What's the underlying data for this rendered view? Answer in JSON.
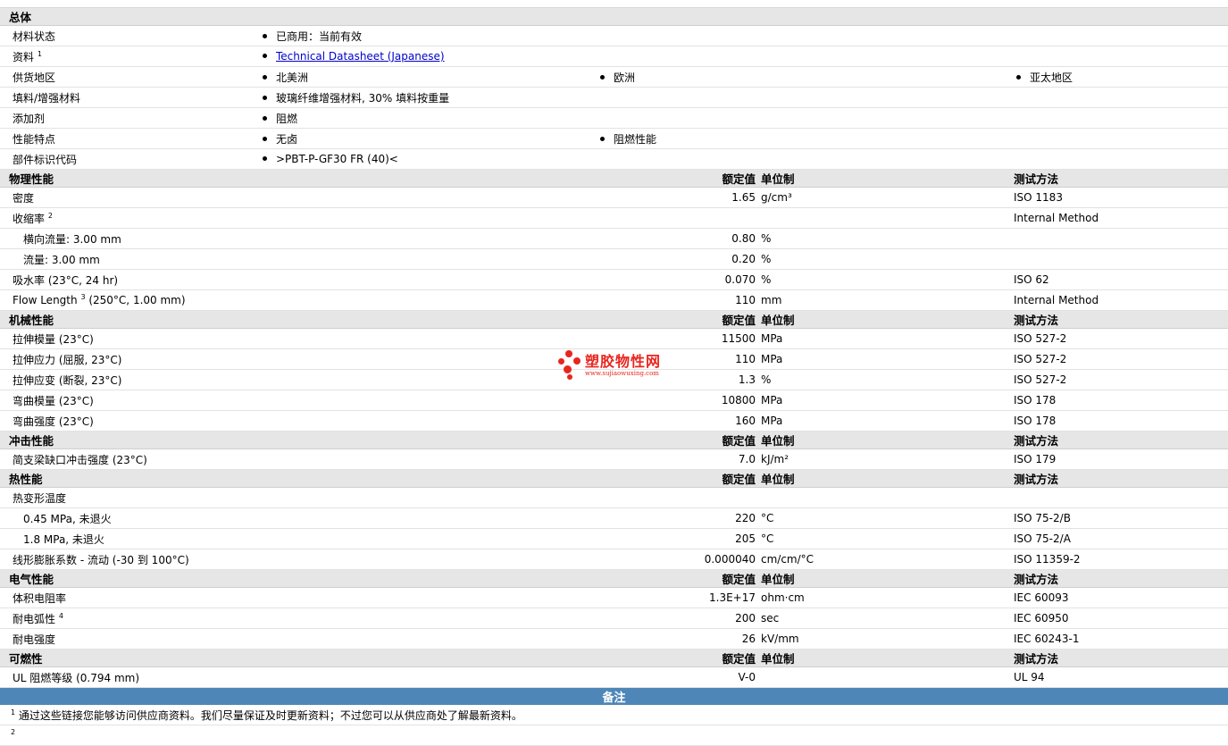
{
  "general": {
    "title": "总体",
    "rows": [
      {
        "label": "材料状态",
        "sup": "",
        "values": [
          "已商用：当前有效"
        ]
      },
      {
        "label": "资料",
        "sup": "1",
        "link": "Technical Datasheet (Japanese)"
      },
      {
        "label": "供货地区",
        "sup": "",
        "values": [
          "北美洲",
          "欧洲",
          "亚太地区"
        ]
      },
      {
        "label": "填料/增强材料",
        "sup": "",
        "values": [
          "玻璃纤维增强材料, 30% 填料按重量"
        ]
      },
      {
        "label": "添加剂",
        "sup": "",
        "values": [
          "阻燃"
        ]
      },
      {
        "label": "性能特点",
        "sup": "",
        "values": [
          "无卤",
          "阻燃性能"
        ]
      },
      {
        "label": "部件标识代码",
        "sup": "",
        "values": [
          ">PBT-P-GF30 FR (40)<"
        ]
      }
    ]
  },
  "headers": {
    "nominal": "额定值",
    "unit": "单位制",
    "method": "测试方法"
  },
  "sections": [
    {
      "title": "物理性能",
      "rows": [
        {
          "label": "密度",
          "sup": "",
          "indent": false,
          "value": "1.65",
          "unit": "g/cm³",
          "method": "ISO 1183"
        },
        {
          "label": "收缩率",
          "sup": "2",
          "indent": false,
          "value": "",
          "unit": "",
          "method": "Internal Method"
        },
        {
          "label": "横向流量: 3.00 mm",
          "sup": "",
          "indent": true,
          "value": "0.80",
          "unit": "%",
          "method": ""
        },
        {
          "label": "流量: 3.00 mm",
          "sup": "",
          "indent": true,
          "value": "0.20",
          "unit": "%",
          "method": ""
        },
        {
          "label": "吸水率  (23°C, 24 hr)",
          "sup": "",
          "indent": false,
          "value": "0.070",
          "unit": "%",
          "method": "ISO 62"
        },
        {
          "label": "Flow Length",
          "sup": "3",
          "suffix": " (250°C, 1.00 mm)",
          "indent": false,
          "value": "110",
          "unit": "mm",
          "method": "Internal Method"
        }
      ]
    },
    {
      "title": "机械性能",
      "rows": [
        {
          "label": "拉伸模量  (23°C)",
          "sup": "",
          "indent": false,
          "value": "11500",
          "unit": "MPa",
          "method": "ISO 527-2"
        },
        {
          "label": "拉伸应力  (屈服, 23°C)",
          "sup": "",
          "indent": false,
          "value": "110",
          "unit": "MPa",
          "method": "ISO 527-2"
        },
        {
          "label": "拉伸应变  (断裂, 23°C)",
          "sup": "",
          "indent": false,
          "value": "1.3",
          "unit": "%",
          "method": "ISO 527-2"
        },
        {
          "label": "弯曲模量  (23°C)",
          "sup": "",
          "indent": false,
          "value": "10800",
          "unit": "MPa",
          "method": "ISO 178"
        },
        {
          "label": "弯曲强度  (23°C)",
          "sup": "",
          "indent": false,
          "value": "160",
          "unit": "MPa",
          "method": "ISO 178"
        }
      ]
    },
    {
      "title": "冲击性能",
      "rows": [
        {
          "label": "简支梁缺口冲击强度  (23°C)",
          "sup": "",
          "indent": false,
          "value": "7.0",
          "unit": "kJ/m²",
          "method": "ISO 179"
        }
      ]
    },
    {
      "title": "热性能",
      "rows": [
        {
          "label": "热变形温度",
          "sup": "",
          "indent": false,
          "value": "",
          "unit": "",
          "method": ""
        },
        {
          "label": "0.45 MPa, 未退火",
          "sup": "",
          "indent": true,
          "value": "220",
          "unit": "°C",
          "method": "ISO 75-2/B"
        },
        {
          "label": "1.8 MPa, 未退火",
          "sup": "",
          "indent": true,
          "value": "205",
          "unit": "°C",
          "method": "ISO 75-2/A"
        },
        {
          "label": "线形膨胀系数  - 流动  (-30 到  100°C)",
          "sup": "",
          "indent": false,
          "value": "0.000040",
          "unit": "cm/cm/°C",
          "method": "ISO 11359-2"
        }
      ]
    },
    {
      "title": "电气性能",
      "rows": [
        {
          "label": "体积电阻率",
          "sup": "",
          "indent": false,
          "value": "1.3E+17",
          "unit": "ohm·cm",
          "method": "IEC 60093"
        },
        {
          "label": "耐电弧性",
          "sup": "4",
          "indent": false,
          "value": "200",
          "unit": "sec",
          "method": "IEC 60950"
        },
        {
          "label": "耐电强度",
          "sup": "",
          "indent": false,
          "value": "26",
          "unit": "kV/mm",
          "method": "IEC 60243-1"
        }
      ]
    },
    {
      "title": "可燃性",
      "rows": [
        {
          "label": "UL 阻燃等级  (0.794 mm)",
          "sup": "",
          "indent": false,
          "value": "V-0",
          "unit": "",
          "method": "UL 94"
        }
      ]
    }
  ],
  "notes": {
    "title": "备注",
    "items": [
      {
        "num": "1",
        "text": "通过这些链接您能够访问供应商资料。我们尽量保证及时更新资料；不过您可以从供应商处了解最新资料。"
      },
      {
        "num": "2",
        "text": ""
      }
    ]
  },
  "watermark": {
    "name": "塑胶物性网",
    "url": "www.sujiaowuxing.com",
    "color": "#e8261e"
  },
  "colors": {
    "section_bg": "#e6e6e6",
    "notes_bar": "#4e86b8",
    "link": "#0000cc"
  }
}
